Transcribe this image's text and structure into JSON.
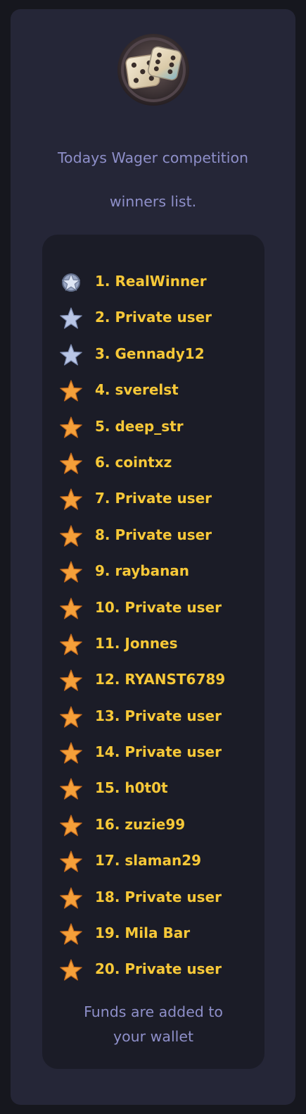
{
  "header": {
    "logo_icon": "dice-icon",
    "title_line1": "Todays Wager competition",
    "title_line2": "winners list."
  },
  "winners": [
    {
      "label": "1. RealWinner",
      "icon": "silver-badge-star-icon"
    },
    {
      "label": "2. Private user",
      "icon": "silver-star-icon"
    },
    {
      "label": "3. Gennady12",
      "icon": "silver-star-icon"
    },
    {
      "label": "4. sverelst",
      "icon": "gold-star-icon"
    },
    {
      "label": "5. deep_str",
      "icon": "gold-star-icon"
    },
    {
      "label": "6. cointxz",
      "icon": "gold-star-icon"
    },
    {
      "label": "7. Private user",
      "icon": "gold-star-icon"
    },
    {
      "label": "8. Private user",
      "icon": "gold-star-icon"
    },
    {
      "label": "9. raybanan",
      "icon": "gold-star-icon"
    },
    {
      "label": "10. Private user",
      "icon": "gold-star-icon"
    },
    {
      "label": "11. Jonnes",
      "icon": "gold-star-icon"
    },
    {
      "label": "12. RYANST6789",
      "icon": "gold-star-icon"
    },
    {
      "label": "13. Private user",
      "icon": "gold-star-icon"
    },
    {
      "label": "14. Private user",
      "icon": "gold-star-icon"
    },
    {
      "label": "15. h0t0t",
      "icon": "gold-star-icon"
    },
    {
      "label": "16. zuzie99",
      "icon": "gold-star-icon"
    },
    {
      "label": "17. slaman29",
      "icon": "gold-star-icon"
    },
    {
      "label": "18. Private user",
      "icon": "gold-star-icon"
    },
    {
      "label": "19. Mila Bar",
      "icon": "gold-star-icon"
    },
    {
      "label": "20. Private user",
      "icon": "gold-star-icon"
    }
  ],
  "footer": {
    "line1": "Funds are added to",
    "line2": "your wallet"
  },
  "colors": {
    "background": "#16171e",
    "card": "#252637",
    "panel": "#1b1c27",
    "title_text": "#8e8fc9",
    "winner_text": "#f7c838",
    "gold_star": "#f5a03a",
    "silver_star": "#b9c6e6"
  }
}
